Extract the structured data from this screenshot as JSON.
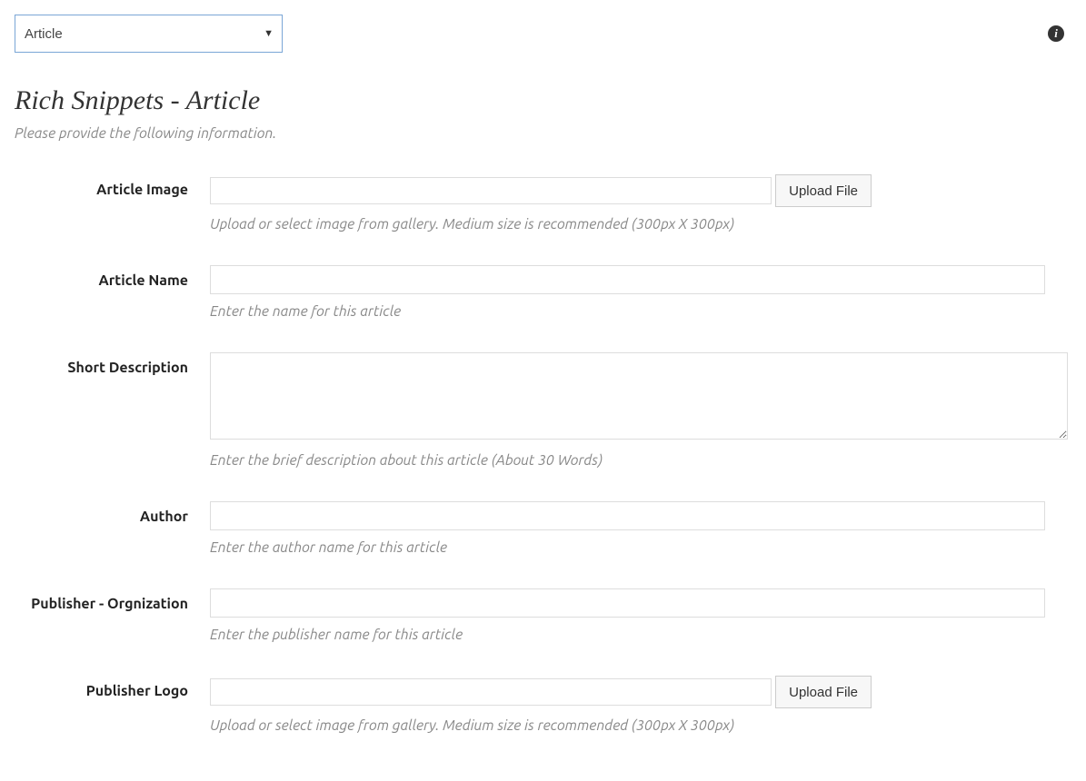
{
  "dropdown": {
    "selected": "Article"
  },
  "header": {
    "title": "Rich Snippets - Article",
    "subtitle": "Please provide the following information."
  },
  "info_icon_glyph": "i",
  "fields": {
    "article_image": {
      "label": "Article Image",
      "button": "Upload File",
      "hint": "Upload or select image from gallery. Medium size is recommended (300px X 300px)"
    },
    "article_name": {
      "label": "Article Name",
      "hint": "Enter the name for this article"
    },
    "short_description": {
      "label": "Short Description",
      "hint": "Enter the brief description about this article (About 30 Words)"
    },
    "author": {
      "label": "Author",
      "hint": "Enter the author name for this article"
    },
    "publisher_org": {
      "label": "Publisher - Orgnization",
      "hint": "Enter the publisher name for this article"
    },
    "publisher_logo": {
      "label": "Publisher Logo",
      "button": "Upload File",
      "hint": "Upload or select image from gallery. Medium size is recommended (300px X 300px)"
    }
  }
}
